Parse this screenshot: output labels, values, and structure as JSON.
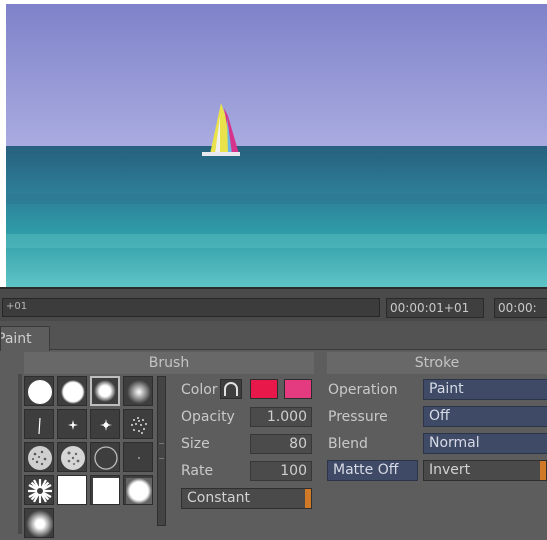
{
  "timeline": {
    "ruler_label": "+01",
    "timecode_current": "00:00:01+01",
    "timecode_end": "00:00:"
  },
  "tab": {
    "label": "Paint"
  },
  "brush": {
    "header": "Brush",
    "color_label": "Color",
    "color_primary": "#e8194a",
    "color_secondary": "#e43b80",
    "opacity_label": "Opacity",
    "opacity_value": "1.000",
    "size_label": "Size",
    "size_value": "80",
    "rate_label": "Rate",
    "rate_value": "100",
    "mode_button": "Constant",
    "presets": [
      "hard-circle",
      "soft-circle",
      "feather-circle",
      "airbrush",
      "hair-line",
      "small-star",
      "sparkle",
      "spray-dots",
      "noise-texture",
      "speckle-texture",
      "hollow-circle",
      "tiny-dot",
      "starburst",
      "white-square",
      "white-square",
      "soft-square",
      "glow-square"
    ],
    "selected_preset_index": 2
  },
  "stroke": {
    "header": "Stroke",
    "operation_label": "Operation",
    "operation_value": "Paint",
    "pressure_label": "Pressure",
    "pressure_value": "Off",
    "blend_label": "Blend",
    "blend_value": "Normal",
    "matte_button": "Matte Off",
    "invert_button": "Invert"
  },
  "colors": {
    "accent_orange": "#d07a28",
    "dropdown_blue": "#3f4a66",
    "panel_gray": "#5d5d5d"
  }
}
